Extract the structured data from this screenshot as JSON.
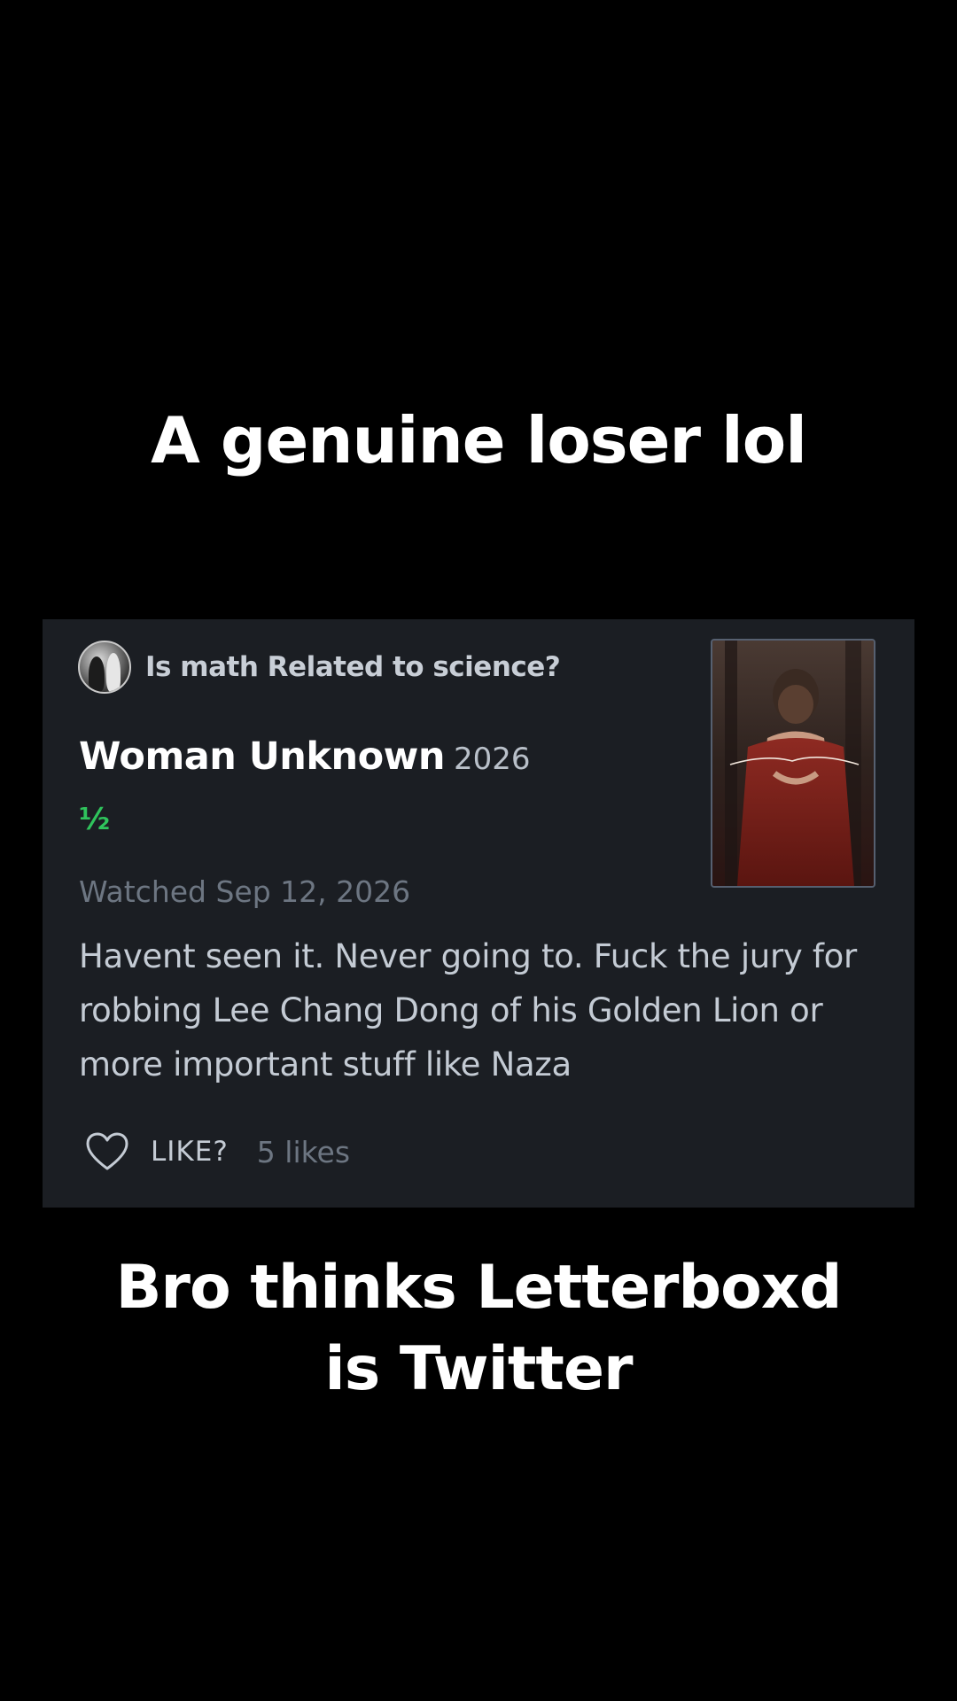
{
  "captions": {
    "top": "A genuine loser lol",
    "bottom": "Bro thinks Letterboxd is Twitter"
  },
  "review_card": {
    "author": "Is math Related to science?",
    "film_title": "Woman Unknown",
    "film_year": "2026",
    "rating": "½",
    "watched": "Watched Sep 12, 2026",
    "review_text": "Havent seen it. Never going to. Fuck the jury for robbing Lee Chang Dong of his Golden Lion or more important stuff like Naza",
    "like_label": "LIKE?",
    "like_count": "5 likes",
    "poster_title": "Woman Unknown"
  },
  "colors": {
    "background": "#000000",
    "card": "#1b1e23",
    "rating_green": "#2fc35c",
    "muted_text": "#6d7682",
    "body_text": "#c4cbd4"
  },
  "icons": [
    "heart-icon"
  ]
}
